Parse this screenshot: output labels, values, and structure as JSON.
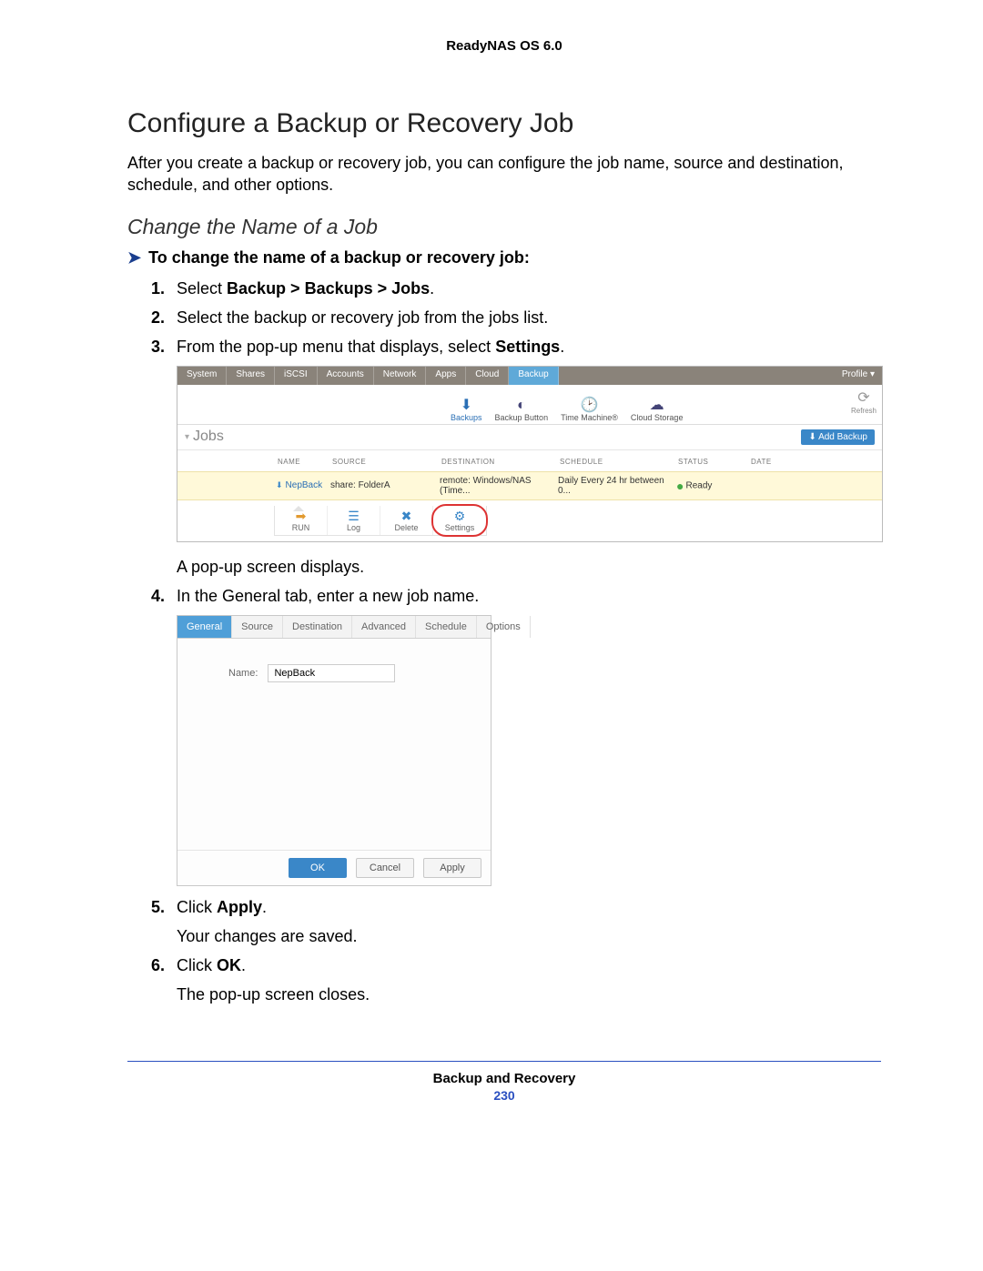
{
  "doc": {
    "product": "ReadyNAS OS 6.0",
    "section_title": "Configure a Backup or Recovery Job",
    "intro": "After you create a backup or recovery job, you can configure the job name, source and destination, schedule, and other options.",
    "subhead": "Change the Name of a Job",
    "task_arrow": "➤",
    "task_line": "To change the name of a backup or recovery job:",
    "steps": {
      "s1_pre": "Select ",
      "s1_bold": "Backup > Backups > Jobs",
      "s1_post": ".",
      "s2": "Select the backup or recovery job from the jobs list.",
      "s3_pre": "From the pop-up menu that displays, select ",
      "s3_bold": "Settings",
      "s3_post": ".",
      "s3_follow": "A pop-up screen displays.",
      "s4": "In the General tab, enter a new job name.",
      "s5_pre": "Click ",
      "s5_bold": "Apply",
      "s5_post": ".",
      "s5_follow": "Your changes are saved.",
      "s6_pre": "Click ",
      "s6_bold": "OK",
      "s6_post": ".",
      "s6_follow": "The pop-up screen closes."
    },
    "footer_title": "Backup and Recovery",
    "footer_page": "230"
  },
  "ss1": {
    "tabs": [
      "System",
      "Shares",
      "iSCSI",
      "Accounts",
      "Network",
      "Apps",
      "Cloud",
      "Backup"
    ],
    "profile": "Profile ▾",
    "tools": {
      "backups": "Backups",
      "backup_button": "Backup Button",
      "time_machine": "Time Machine®",
      "cloud_storage": "Cloud Storage",
      "refresh": "Refresh"
    },
    "jobs_label": "Jobs",
    "add_backup": "Add Backup",
    "cols": {
      "name": "NAME",
      "source": "SOURCE",
      "destination": "DESTINATION",
      "schedule": "SCHEDULE",
      "status": "STATUS",
      "date": "DATE"
    },
    "row": {
      "name": "NepBack",
      "source": "share: FolderA",
      "destination": "remote: Windows/NAS (Time...",
      "schedule": "Daily Every 24 hr between 0...",
      "status": "Ready"
    },
    "actions": {
      "run": "RUN",
      "log": "Log",
      "delete": "Delete",
      "settings": "Settings"
    }
  },
  "ss2": {
    "tabs": [
      "General",
      "Source",
      "Destination",
      "Advanced",
      "Schedule",
      "Options"
    ],
    "name_label": "Name:",
    "name_value": "NepBack",
    "buttons": {
      "ok": "OK",
      "cancel": "Cancel",
      "apply": "Apply"
    }
  }
}
